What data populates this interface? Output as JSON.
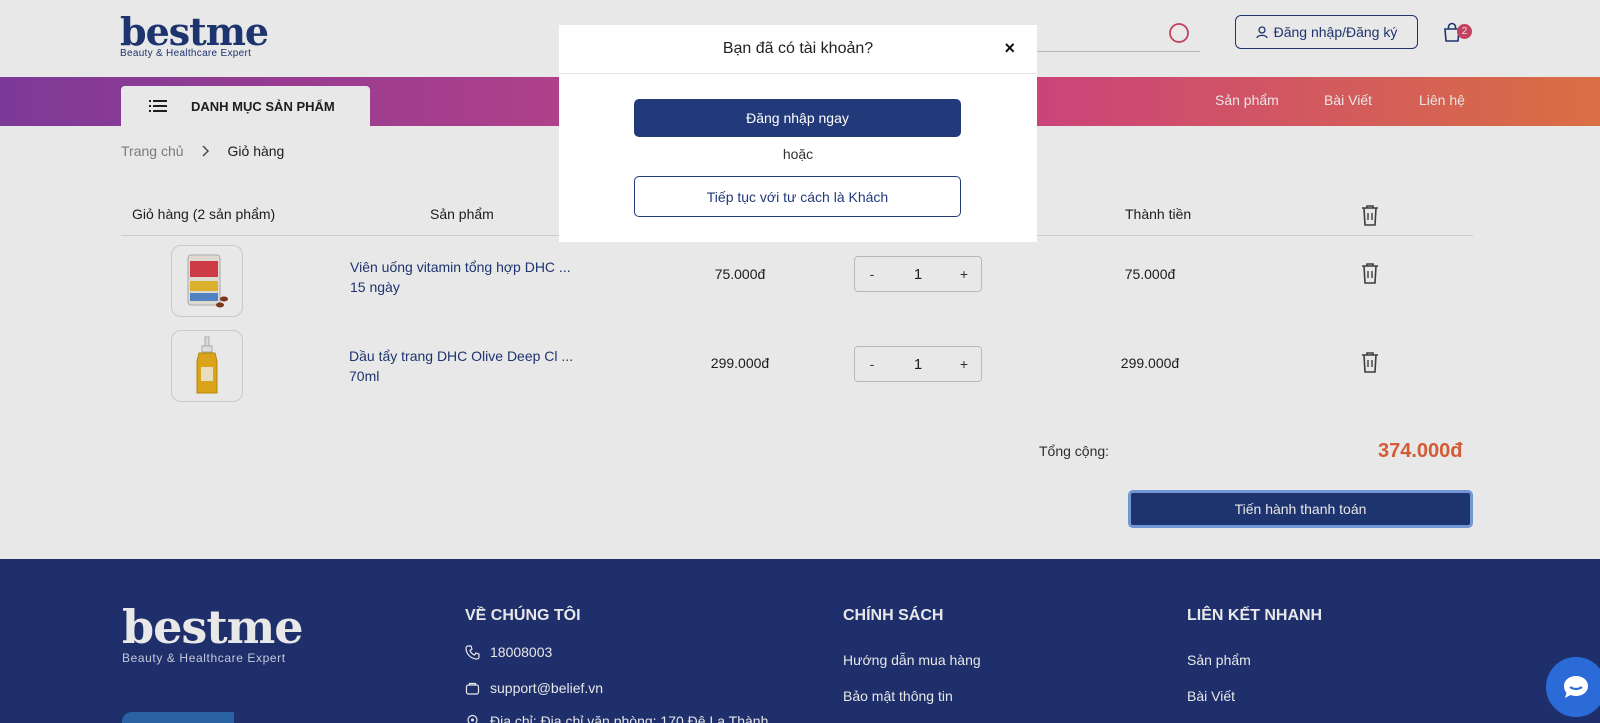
{
  "header": {
    "logo_text": "bestme",
    "logo_tagline": "Beauty & Healthcare Expert",
    "login_label": "Đăng nhập/Đăng ký",
    "cart_count": "2"
  },
  "nav": {
    "category_label": "DANH MỤC SẢN PHẨM",
    "links": [
      "Sản phẩm",
      "Bài Viết",
      "Liên hệ"
    ]
  },
  "breadcrumb": {
    "home": "Trang chủ",
    "current": "Giỏ hàng"
  },
  "cart": {
    "headers": {
      "title": "Giỏ hàng (2 sản phẩm)",
      "product": "Sản phẩm",
      "subtotal": "Thành tiền"
    },
    "items": [
      {
        "name": "Viên uống vitamin tổng hợp DHC ...",
        "variant": "15 ngày",
        "price": "75.000đ",
        "qty": "1",
        "subtotal": "75.000đ"
      },
      {
        "name": "Dầu tẩy trang DHC Olive Deep Cl ...",
        "variant": "70ml",
        "price": "299.000đ",
        "qty": "1",
        "subtotal": "299.000đ"
      }
    ],
    "qty_minus": "-",
    "qty_plus": "+",
    "total_label": "Tổng cộng:",
    "total_value": "374.000đ",
    "checkout_label": "Tiến hành thanh toán"
  },
  "footer": {
    "logo_text": "bestme",
    "logo_tagline": "Beauty & Healthcare Expert",
    "about_title": "VỀ CHÚNG TÔI",
    "phone": "18008003",
    "email": "support@belief.vn",
    "address": "Địa chỉ: Địa chỉ văn phòng: 170 Đê La Thành",
    "policy_title": "CHÍNH SÁCH",
    "policy_items": [
      "Hướng dẫn mua hàng",
      "Bảo mật thông tin"
    ],
    "quick_title": "LIÊN KẾT NHANH",
    "quick_items": [
      "Sản phẩm",
      "Bài Viết"
    ]
  },
  "modal": {
    "title": "Bạn đã có tài khoản?",
    "close": "×",
    "login_label": "Đăng nhập ngay",
    "or_label": "hoặc",
    "guest_label": "Tiếp tục với tư cách là Khách"
  },
  "colors": {
    "brand": "#223a7a",
    "accent": "#d9486a",
    "total": "#e8643c"
  }
}
